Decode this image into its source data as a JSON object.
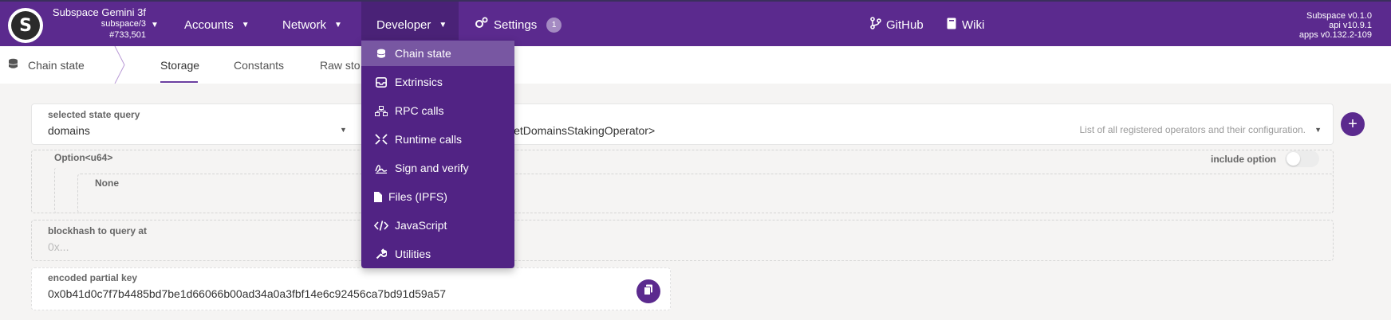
{
  "header": {
    "chain_name": "Subspace Gemini 3f",
    "chain_runtime": "subspace/3",
    "chain_block": "#733,501",
    "logo_letter": "S",
    "nav": [
      {
        "label": "Accounts"
      },
      {
        "label": "Network"
      },
      {
        "label": "Developer"
      },
      {
        "label": "Settings",
        "badge": "1"
      }
    ],
    "links": [
      {
        "label": "GitHub"
      },
      {
        "label": "Wiki"
      }
    ],
    "versions": {
      "runtime": "Subspace v0.1.0",
      "api": "api v10.9.1",
      "apps": "apps v0.132.2-109"
    }
  },
  "subnav": {
    "section": "Chain state",
    "tabs": [
      {
        "label": "Storage"
      },
      {
        "label": "Constants"
      },
      {
        "label": "Raw sto"
      }
    ]
  },
  "developer_menu": {
    "items": [
      {
        "label": "Chain state",
        "icon": "database-icon"
      },
      {
        "label": "Extrinsics",
        "icon": "inbox-icon"
      },
      {
        "label": "RPC calls",
        "icon": "network-icon"
      },
      {
        "label": "Runtime calls",
        "icon": "arrows-icon"
      },
      {
        "label": "Sign and verify",
        "icon": "signature-icon"
      },
      {
        "label": "Files (IPFS)",
        "icon": "file-icon"
      },
      {
        "label": "JavaScript",
        "icon": "code-icon"
      },
      {
        "label": "Utilities",
        "icon": "wrench-icon"
      }
    ]
  },
  "query": {
    "selected_label": "selected state query",
    "module_value": "domains",
    "method_value_partial": "letDomainsStakingOperator>",
    "method_description": "List of all registered operators and their configuration.",
    "param_type": "Option<u64>",
    "include_option_label": "include option",
    "none_label": "None",
    "blockhash_label": "blockhash to query at",
    "blockhash_placeholder": "0x...",
    "encoded_label": "encoded partial key",
    "encoded_value": "0x0b41d0c7f7b4485bd7be1d66066b00ad34a0a3fbf14e6c92456ca7bd91d59a57"
  },
  "colors": {
    "brand": "#5b2a8e",
    "menu_bg": "#512384",
    "menu_highlight": "#7857a2"
  }
}
